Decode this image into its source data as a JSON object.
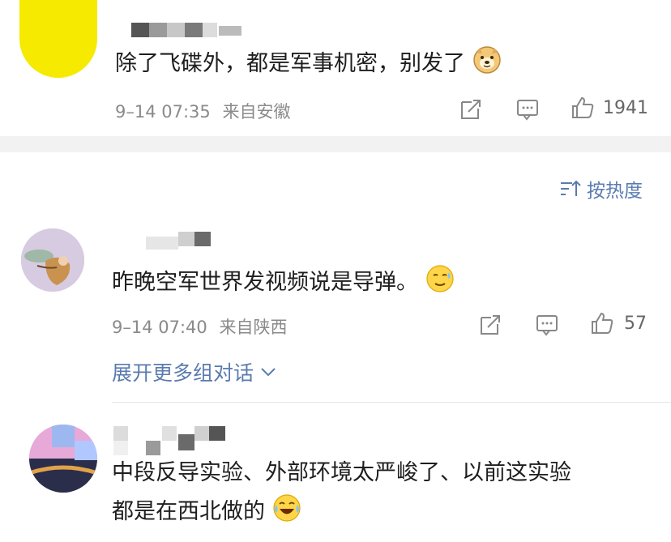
{
  "comments": [
    {
      "text": "除了飞碟外，都是军事机密，别发了",
      "date": "9–14 07:35",
      "location": "来自安徽",
      "likes": "1941",
      "emoji": "doge-icon",
      "avatar_color": "#f5ea00"
    },
    {
      "text": "昨晚空军世界发视频说是导弹。",
      "date": "9–14 07:40",
      "location": "来自陕西",
      "likes": "57",
      "emoji": "sweat-smile-icon"
    },
    {
      "text_line1": "中段反导实验、外部环境太严峻了、以前这实验",
      "text_line2": "都是在西北做的",
      "emoji": "laugh-cry-icon"
    }
  ],
  "sort_label": "按热度",
  "expand_label": "展开更多组对话",
  "colors": {
    "link": "#5a7bb0",
    "separator": "#f2f2f2",
    "meta": "#8a8a8a"
  }
}
